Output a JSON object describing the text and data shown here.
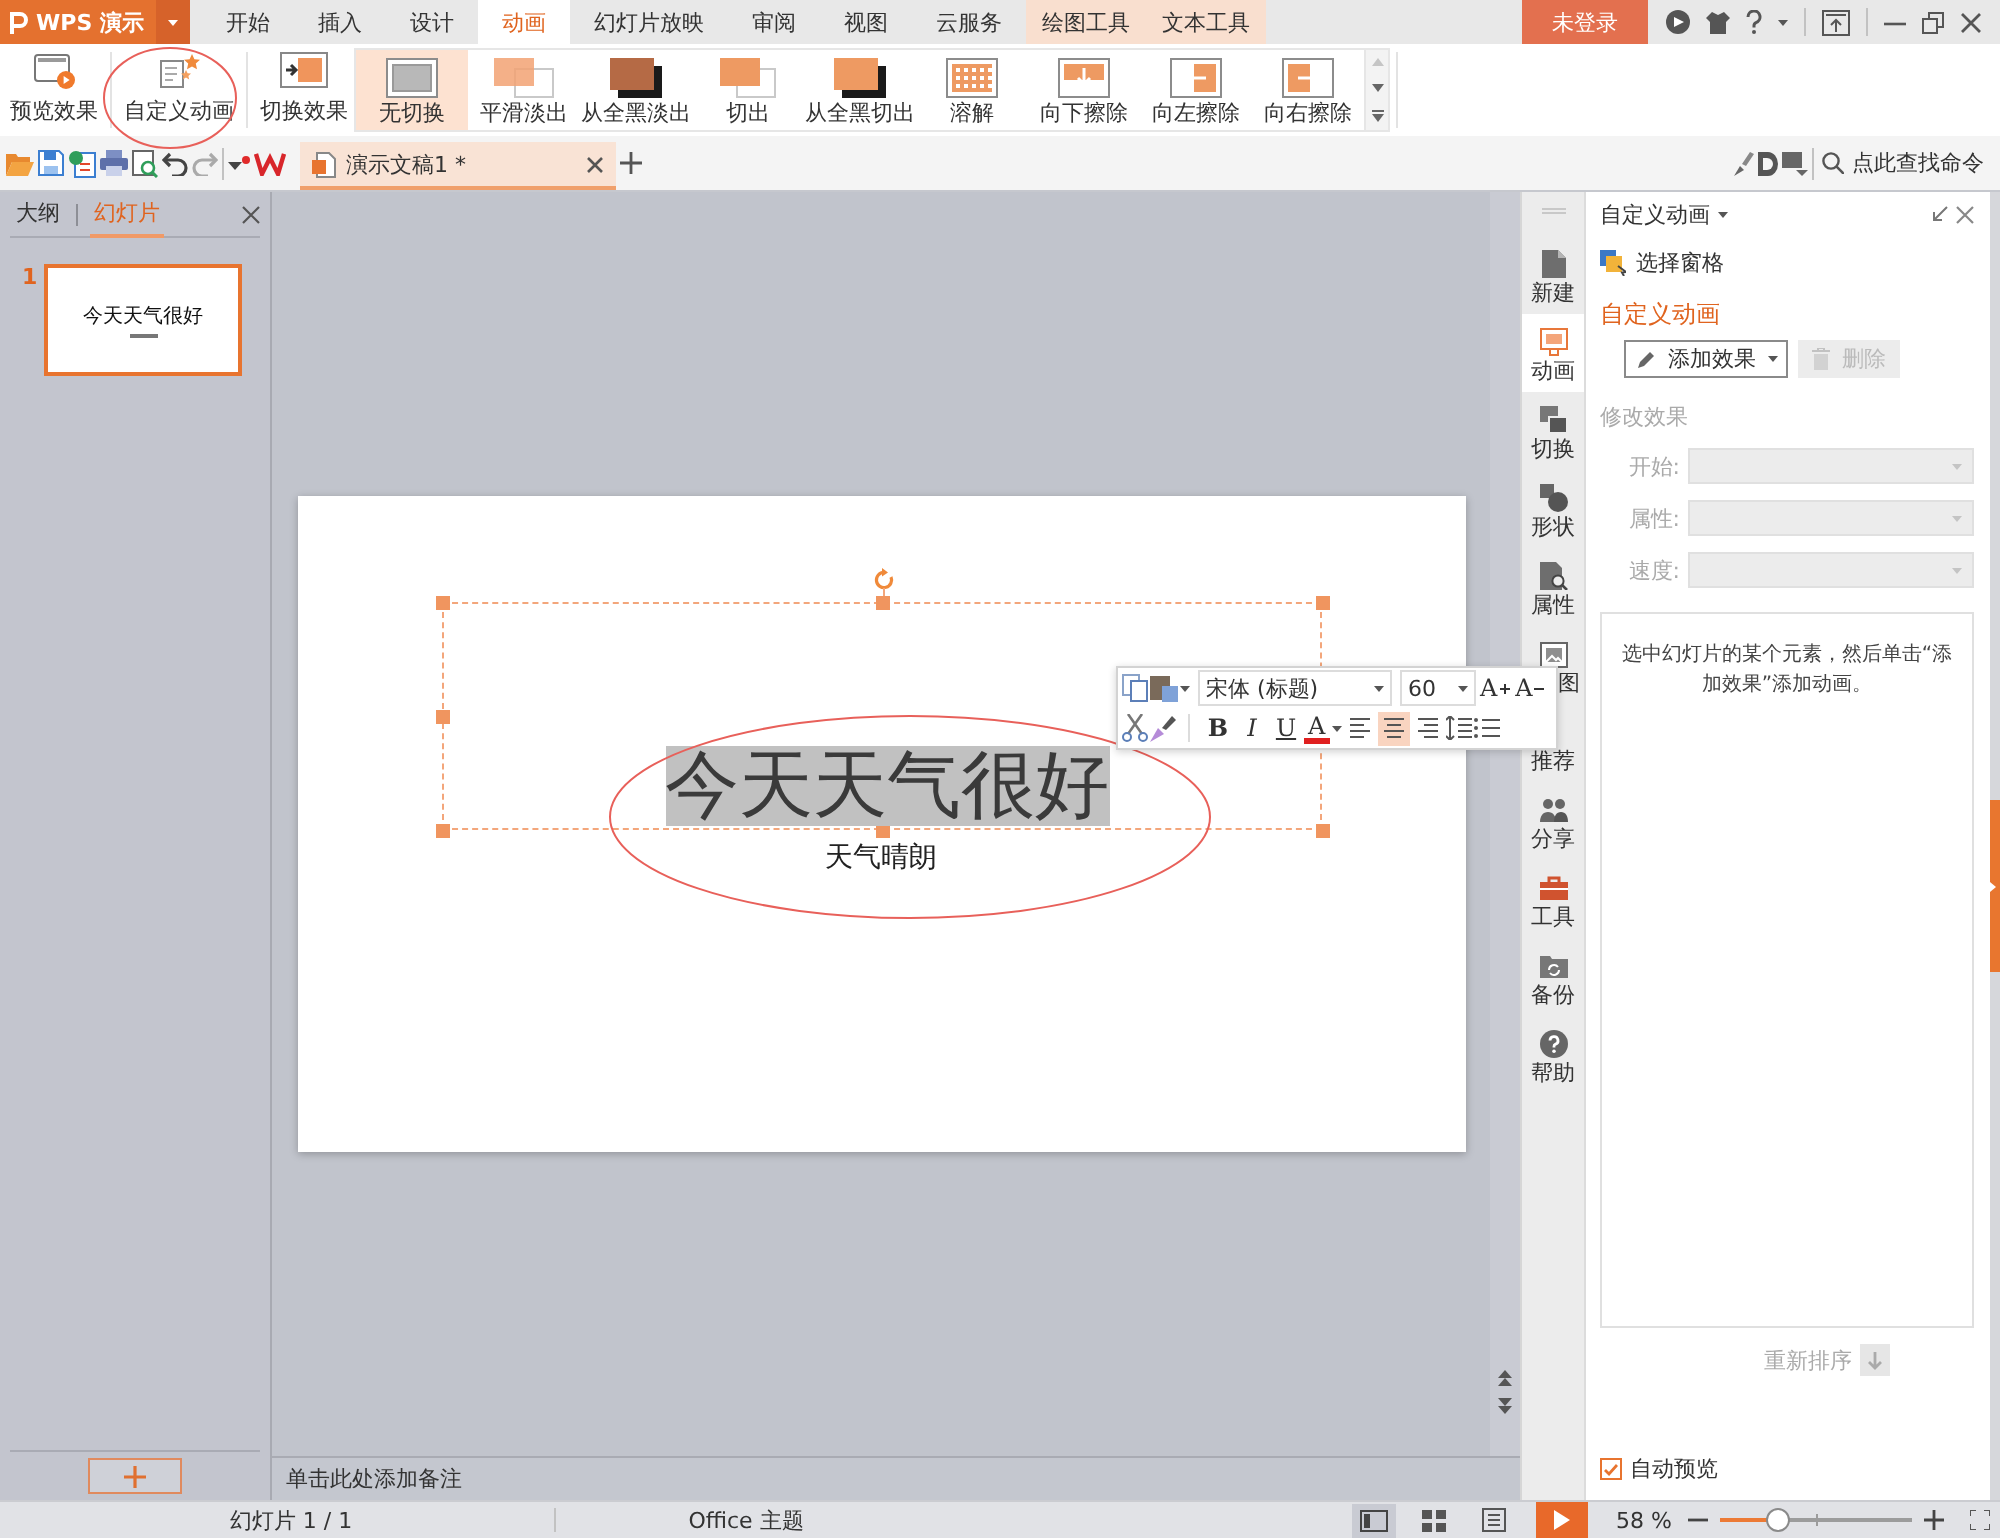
{
  "app_button": {
    "label": "WPS 演示"
  },
  "menu_tabs": [
    {
      "label": "开始",
      "kind": "main",
      "selected": false
    },
    {
      "label": "插入",
      "kind": "main",
      "selected": false
    },
    {
      "label": "设计",
      "kind": "main",
      "selected": false
    },
    {
      "label": "动画",
      "kind": "main",
      "selected": true
    },
    {
      "label": "幻灯片放映",
      "kind": "main",
      "selected": false
    },
    {
      "label": "审阅",
      "kind": "main",
      "selected": false
    },
    {
      "label": "视图",
      "kind": "main",
      "selected": false
    },
    {
      "label": "云服务",
      "kind": "main",
      "selected": false
    },
    {
      "label": "绘图工具",
      "kind": "context",
      "selected": false
    },
    {
      "label": "文本工具",
      "kind": "context",
      "selected": false
    }
  ],
  "account": {
    "label": "未登录"
  },
  "ribbon": {
    "commands": [
      {
        "label": "预览效果",
        "kind": "preview"
      },
      {
        "label": "自定义动画",
        "kind": "custom"
      },
      {
        "label": "切换效果",
        "kind": "switch"
      }
    ],
    "transitions": [
      {
        "label": "无切换",
        "kind": "none",
        "selected": true
      },
      {
        "label": "平滑淡出",
        "kind": "fade",
        "selected": false
      },
      {
        "label": "从全黑淡出",
        "kind": "fade_black",
        "selected": false
      },
      {
        "label": "切出",
        "kind": "cut",
        "selected": false
      },
      {
        "label": "从全黑切出",
        "kind": "cut_black",
        "selected": false
      },
      {
        "label": "溶解",
        "kind": "dissolve",
        "selected": false
      },
      {
        "label": "向下擦除",
        "kind": "wipe_down",
        "selected": false
      },
      {
        "label": "向左擦除",
        "kind": "wipe_left",
        "selected": false
      },
      {
        "label": "向右擦除",
        "kind": "wipe_right",
        "selected": false
      }
    ]
  },
  "document_tabs": [
    {
      "title": "演示文稿1 *",
      "selected": true
    }
  ],
  "command_search": {
    "placeholder": "点此查找命令"
  },
  "slide_panel": {
    "tabs": [
      {
        "label": "大纲",
        "selected": false
      },
      {
        "label": "幻灯片",
        "selected": true
      }
    ],
    "slides": [
      {
        "number": "1",
        "title": "今天天气很好",
        "selected": true
      }
    ]
  },
  "slide": {
    "title": "今天天气很好",
    "title_highlighted": true,
    "subtitle": "天气晴朗"
  },
  "notes": {
    "placeholder": "单击此处添加备注"
  },
  "mini_toolbar": {
    "font": "宋体 (标题)",
    "size": "60",
    "size_buttons": [
      {
        "label": "A",
        "kind": "grow"
      },
      {
        "label": "A",
        "kind": "shrink"
      }
    ],
    "styles": [
      {
        "label": "B",
        "kind": "bold",
        "on": false
      },
      {
        "label": "I",
        "kind": "italic",
        "on": false
      },
      {
        "label": "U",
        "kind": "underline",
        "on": false
      }
    ],
    "font_color": {
      "label": "A"
    },
    "alignments": [
      {
        "kind": "left",
        "selected": false
      },
      {
        "kind": "center",
        "selected": true
      },
      {
        "kind": "right",
        "selected": false
      }
    ]
  },
  "side_tabs": [
    {
      "label": "新建",
      "kind": "new",
      "selected": false
    },
    {
      "label": "动画",
      "kind": "animation",
      "selected": true
    },
    {
      "label": "切换",
      "kind": "switch",
      "selected": false
    },
    {
      "label": "形状",
      "kind": "shape",
      "selected": false
    },
    {
      "label": "属性",
      "kind": "property",
      "selected": false
    },
    {
      "label": "图",
      "kind": "picture",
      "selected": false
    },
    {
      "label": "推荐",
      "kind": "recommend",
      "selected": false
    },
    {
      "label": "分享",
      "kind": "share",
      "selected": false
    },
    {
      "label": "工具",
      "kind": "tools",
      "selected": false
    },
    {
      "label": "备份",
      "kind": "backup",
      "selected": false
    },
    {
      "label": "帮助",
      "kind": "help",
      "selected": false
    }
  ],
  "task_pane": {
    "title": "自定义动画",
    "selection_pane": "选择窗格",
    "heading": "自定义动画",
    "add_effect": {
      "label": "添加效果"
    },
    "remove": {
      "label": "删除",
      "disabled": true
    },
    "modify_heading": "修改效果",
    "fields": [
      {
        "label": "开始:",
        "disabled": true
      },
      {
        "label": "属性:",
        "disabled": true
      },
      {
        "label": "速度:",
        "disabled": true
      }
    ],
    "hint": "选中幻灯片的某个元素，然后单击“添加效果”添加动画。",
    "reorder": "重新排序",
    "auto_preview": {
      "label": "自动预览",
      "checked": true
    }
  },
  "status_bar": {
    "slide_count": "幻灯片 1 / 1",
    "theme": "Office 主题",
    "views": [
      {
        "kind": "normal",
        "selected": true
      },
      {
        "kind": "sorter",
        "selected": false
      },
      {
        "kind": "reading",
        "selected": false
      }
    ],
    "zoom": "58 %",
    "zoom_slider": {
      "level": 0.3
    }
  }
}
